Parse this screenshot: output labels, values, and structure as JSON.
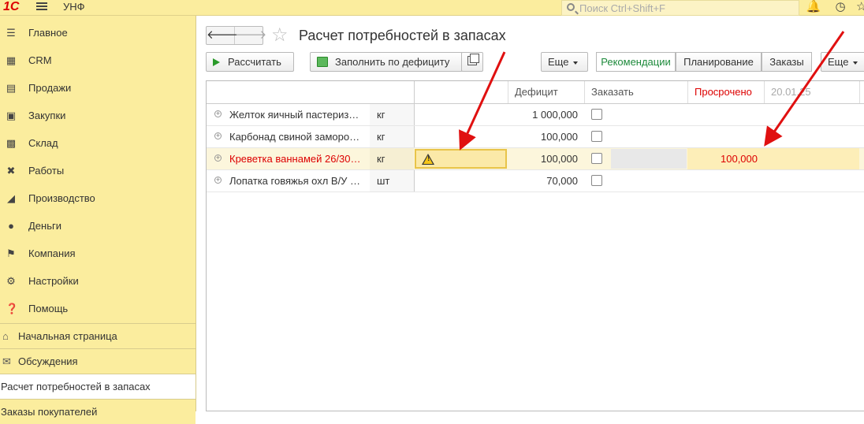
{
  "topbar": {
    "logo": "1С",
    "app_name": "УНФ",
    "search_placeholder": "Поиск Ctrl+Shift+F"
  },
  "sidebar": {
    "items": [
      {
        "label": "Главное",
        "icon": "menu-lines-icon"
      },
      {
        "label": "CRM",
        "icon": "contact-card-icon"
      },
      {
        "label": "Продажи",
        "icon": "basket-icon"
      },
      {
        "label": "Закупки",
        "icon": "cart-icon"
      },
      {
        "label": "Склад",
        "icon": "warehouse-grid-icon"
      },
      {
        "label": "Работы",
        "icon": "tools-icon"
      },
      {
        "label": "Производство",
        "icon": "factory-icon"
      },
      {
        "label": "Деньги",
        "icon": "ruble-coin-icon"
      },
      {
        "label": "Компания",
        "icon": "flag-icon"
      },
      {
        "label": "Настройки",
        "icon": "gear-icon"
      },
      {
        "label": "Помощь",
        "icon": "help-icon"
      }
    ],
    "sections": [
      {
        "label": "Начальная страница",
        "icon": "home-icon"
      },
      {
        "label": "Обсуждения",
        "icon": "chat-icon"
      },
      {
        "label": "Расчет потребностей в запасах"
      },
      {
        "label": "Заказы покупателей"
      }
    ]
  },
  "form": {
    "title": "Расчет потребностей в запасах",
    "buttons": {
      "calculate": "Рассчитать",
      "fill_deficit": "Заполнить по дефициту",
      "more": "Еще",
      "recommendations": "Рекомендации",
      "planning": "Планирование",
      "orders": "Заказы",
      "more2": "Еще"
    }
  },
  "table": {
    "headers": {
      "deficit": "Дефицит",
      "order": "Заказать",
      "overdue": "Просрочено",
      "date": "20.01.25"
    },
    "rows": [
      {
        "name": "Желток яичный пастериз…",
        "unit": "кг",
        "deficit": "1 000,000",
        "overdue": ""
      },
      {
        "name": "Карбонад свиной заморо…",
        "unit": "кг",
        "deficit": "100,000",
        "overdue": ""
      },
      {
        "name": "Креветка ваннамей 26/30…",
        "unit": "кг",
        "deficit": "100,000",
        "overdue": "100,000"
      },
      {
        "name": "Лопатка говяжья охл В/У …",
        "unit": "шт",
        "deficit": "70,000",
        "overdue": ""
      }
    ]
  },
  "colors": {
    "sidebar_bg": "#fbed9e",
    "accent_green": "#1d8a3b",
    "alert_red": "#d00000",
    "annotation_arrow": "#e01010"
  }
}
